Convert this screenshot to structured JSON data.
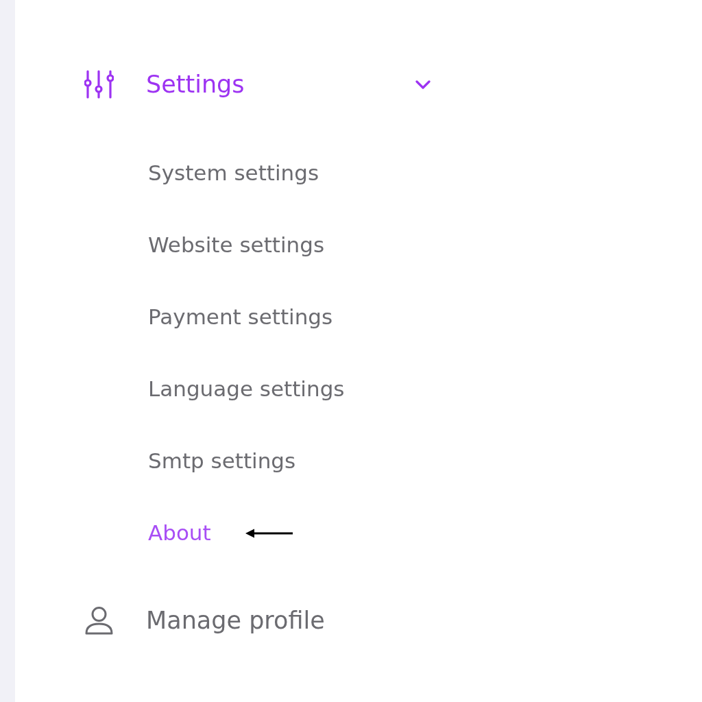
{
  "sidebar": {
    "items": [
      {
        "kind": "group",
        "label": "Settings",
        "expanded": true,
        "selected": true,
        "children": [
          {
            "label": "System settings",
            "selected": false,
            "marked": false
          },
          {
            "label": "Website settings",
            "selected": false,
            "marked": false
          },
          {
            "label": "Payment settings",
            "selected": false,
            "marked": false
          },
          {
            "label": "Language settings",
            "selected": false,
            "marked": false
          },
          {
            "label": "Smtp settings",
            "selected": false,
            "marked": false
          },
          {
            "label": "About",
            "selected": true,
            "marked": true
          }
        ]
      },
      {
        "kind": "link",
        "label": "Manage profile",
        "selected": false
      }
    ]
  }
}
